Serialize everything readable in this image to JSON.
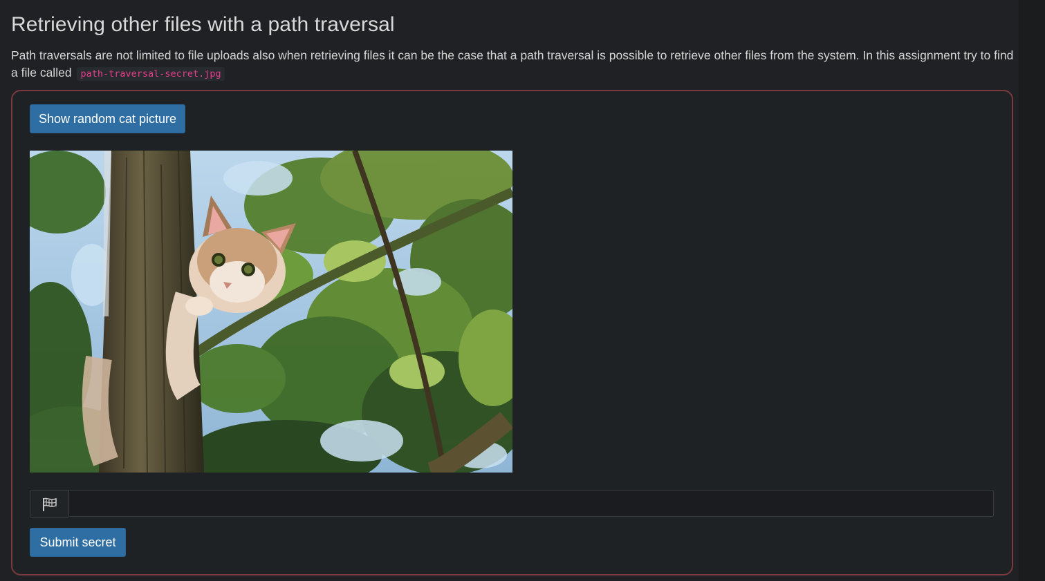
{
  "assignment": {
    "title": "Retrieving other files with a path traversal",
    "description_text": "Path traversals are not limited to file uploads also when retrieving files it can be the case that a path traversal is possible to retrieve other files from the system. In this assignment try to find a file called",
    "description_code": "path-traversal-secret.jpg"
  },
  "panel": {
    "show_cat_button": "Show random cat picture",
    "image": {
      "icon": "cat-in-tree-photo"
    },
    "secret_input": {
      "icon": "flag-icon",
      "value": "",
      "placeholder": ""
    },
    "submit_button": "Submit secret"
  },
  "colors": {
    "background": "#1f2124",
    "primary_button": "#2f6ea3",
    "panel_border": "#7a3a3e",
    "code_text": "#e83e8c"
  }
}
